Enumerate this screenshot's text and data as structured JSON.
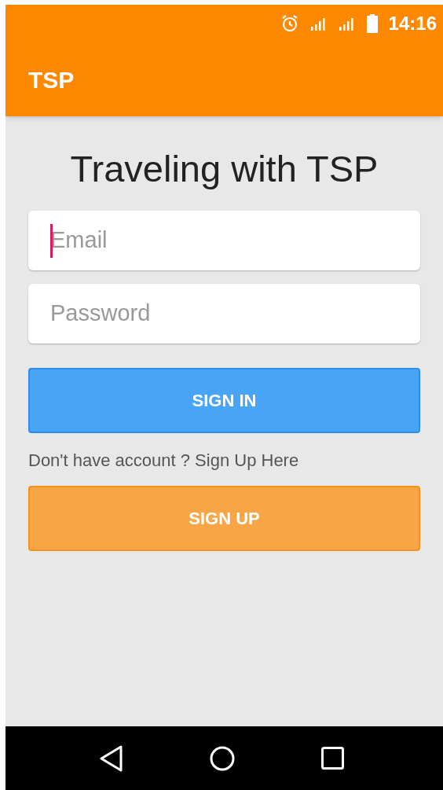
{
  "status_bar": {
    "time": "14:16"
  },
  "app_bar": {
    "title": "TSP"
  },
  "heading": "Traveling with TSP",
  "fields": [
    {
      "placeholder": "Email",
      "focused": true
    },
    {
      "placeholder": "Password",
      "focused": false
    }
  ],
  "sign_in_button": "SIGN IN",
  "prompt": "Don't have account ? Sign Up Here",
  "sign_up_button": "SIGN UP"
}
